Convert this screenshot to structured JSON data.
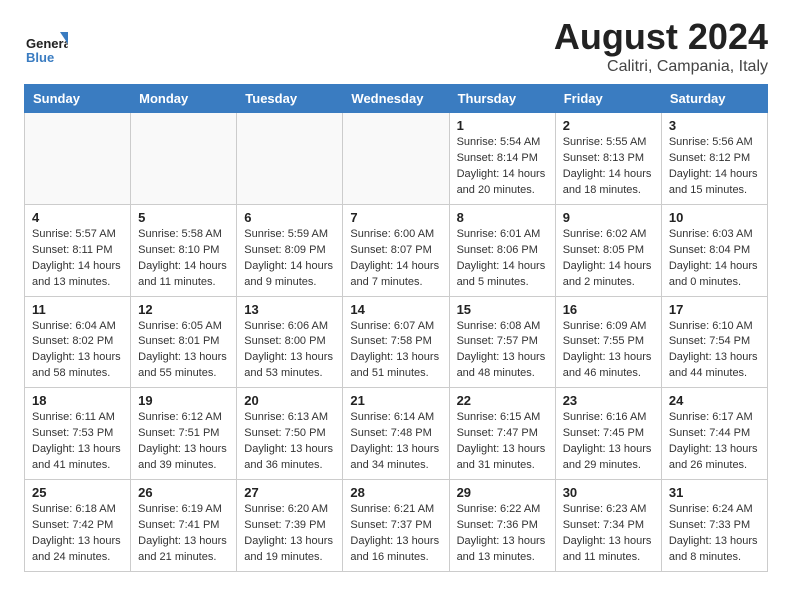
{
  "header": {
    "logo_general": "General",
    "logo_blue": "Blue",
    "month": "August 2024",
    "location": "Calitri, Campania, Italy"
  },
  "weekdays": [
    "Sunday",
    "Monday",
    "Tuesday",
    "Wednesday",
    "Thursday",
    "Friday",
    "Saturday"
  ],
  "weeks": [
    [
      {
        "day": "",
        "empty": true
      },
      {
        "day": "",
        "empty": true
      },
      {
        "day": "",
        "empty": true
      },
      {
        "day": "",
        "empty": true
      },
      {
        "day": "1",
        "sunrise": "5:54 AM",
        "sunset": "8:14 PM",
        "daylight": "14 hours and 20 minutes."
      },
      {
        "day": "2",
        "sunrise": "5:55 AM",
        "sunset": "8:13 PM",
        "daylight": "14 hours and 18 minutes."
      },
      {
        "day": "3",
        "sunrise": "5:56 AM",
        "sunset": "8:12 PM",
        "daylight": "14 hours and 15 minutes."
      }
    ],
    [
      {
        "day": "4",
        "sunrise": "5:57 AM",
        "sunset": "8:11 PM",
        "daylight": "14 hours and 13 minutes."
      },
      {
        "day": "5",
        "sunrise": "5:58 AM",
        "sunset": "8:10 PM",
        "daylight": "14 hours and 11 minutes."
      },
      {
        "day": "6",
        "sunrise": "5:59 AM",
        "sunset": "8:09 PM",
        "daylight": "14 hours and 9 minutes."
      },
      {
        "day": "7",
        "sunrise": "6:00 AM",
        "sunset": "8:07 PM",
        "daylight": "14 hours and 7 minutes."
      },
      {
        "day": "8",
        "sunrise": "6:01 AM",
        "sunset": "8:06 PM",
        "daylight": "14 hours and 5 minutes."
      },
      {
        "day": "9",
        "sunrise": "6:02 AM",
        "sunset": "8:05 PM",
        "daylight": "14 hours and 2 minutes."
      },
      {
        "day": "10",
        "sunrise": "6:03 AM",
        "sunset": "8:04 PM",
        "daylight": "14 hours and 0 minutes."
      }
    ],
    [
      {
        "day": "11",
        "sunrise": "6:04 AM",
        "sunset": "8:02 PM",
        "daylight": "13 hours and 58 minutes."
      },
      {
        "day": "12",
        "sunrise": "6:05 AM",
        "sunset": "8:01 PM",
        "daylight": "13 hours and 55 minutes."
      },
      {
        "day": "13",
        "sunrise": "6:06 AM",
        "sunset": "8:00 PM",
        "daylight": "13 hours and 53 minutes."
      },
      {
        "day": "14",
        "sunrise": "6:07 AM",
        "sunset": "7:58 PM",
        "daylight": "13 hours and 51 minutes."
      },
      {
        "day": "15",
        "sunrise": "6:08 AM",
        "sunset": "7:57 PM",
        "daylight": "13 hours and 48 minutes."
      },
      {
        "day": "16",
        "sunrise": "6:09 AM",
        "sunset": "7:55 PM",
        "daylight": "13 hours and 46 minutes."
      },
      {
        "day": "17",
        "sunrise": "6:10 AM",
        "sunset": "7:54 PM",
        "daylight": "13 hours and 44 minutes."
      }
    ],
    [
      {
        "day": "18",
        "sunrise": "6:11 AM",
        "sunset": "7:53 PM",
        "daylight": "13 hours and 41 minutes."
      },
      {
        "day": "19",
        "sunrise": "6:12 AM",
        "sunset": "7:51 PM",
        "daylight": "13 hours and 39 minutes."
      },
      {
        "day": "20",
        "sunrise": "6:13 AM",
        "sunset": "7:50 PM",
        "daylight": "13 hours and 36 minutes."
      },
      {
        "day": "21",
        "sunrise": "6:14 AM",
        "sunset": "7:48 PM",
        "daylight": "13 hours and 34 minutes."
      },
      {
        "day": "22",
        "sunrise": "6:15 AM",
        "sunset": "7:47 PM",
        "daylight": "13 hours and 31 minutes."
      },
      {
        "day": "23",
        "sunrise": "6:16 AM",
        "sunset": "7:45 PM",
        "daylight": "13 hours and 29 minutes."
      },
      {
        "day": "24",
        "sunrise": "6:17 AM",
        "sunset": "7:44 PM",
        "daylight": "13 hours and 26 minutes."
      }
    ],
    [
      {
        "day": "25",
        "sunrise": "6:18 AM",
        "sunset": "7:42 PM",
        "daylight": "13 hours and 24 minutes."
      },
      {
        "day": "26",
        "sunrise": "6:19 AM",
        "sunset": "7:41 PM",
        "daylight": "13 hours and 21 minutes."
      },
      {
        "day": "27",
        "sunrise": "6:20 AM",
        "sunset": "7:39 PM",
        "daylight": "13 hours and 19 minutes."
      },
      {
        "day": "28",
        "sunrise": "6:21 AM",
        "sunset": "7:37 PM",
        "daylight": "13 hours and 16 minutes."
      },
      {
        "day": "29",
        "sunrise": "6:22 AM",
        "sunset": "7:36 PM",
        "daylight": "13 hours and 13 minutes."
      },
      {
        "day": "30",
        "sunrise": "6:23 AM",
        "sunset": "7:34 PM",
        "daylight": "13 hours and 11 minutes."
      },
      {
        "day": "31",
        "sunrise": "6:24 AM",
        "sunset": "7:33 PM",
        "daylight": "13 hours and 8 minutes."
      }
    ]
  ],
  "labels": {
    "sunrise": "Sunrise:",
    "sunset": "Sunset:",
    "daylight": "Daylight:"
  }
}
